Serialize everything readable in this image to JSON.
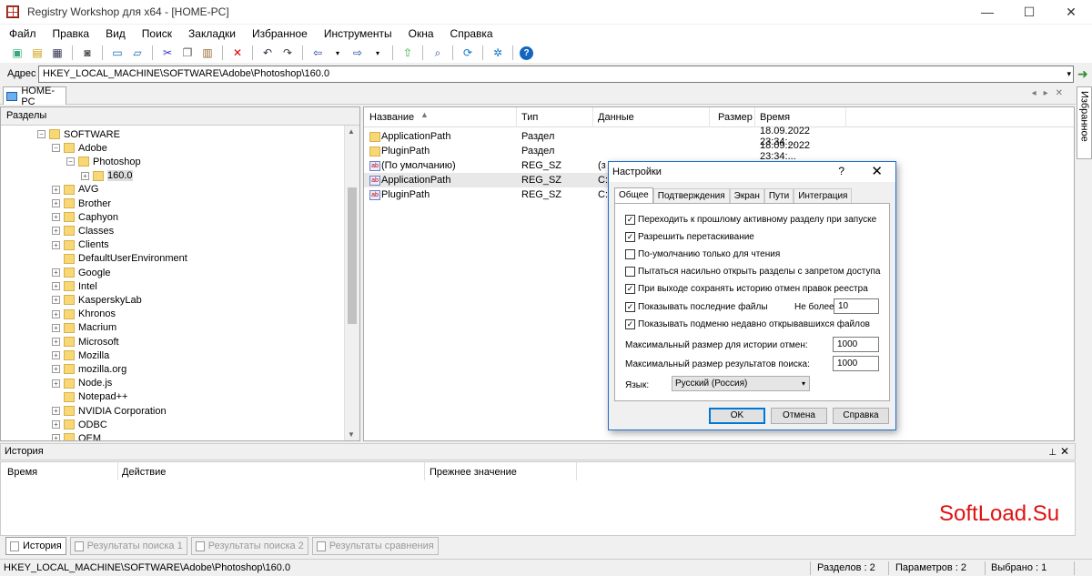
{
  "window": {
    "title": "Registry Workshop для x64 - [HOME-PC]",
    "minimize": "—",
    "maximize": "☐",
    "close": "✕"
  },
  "menu": [
    "Файл",
    "Правка",
    "Вид",
    "Поиск",
    "Закладки",
    "Избранное",
    "Инструменты",
    "Окна",
    "Справка"
  ],
  "address": {
    "label": "Адрес",
    "value": "HKEY_LOCAL_MACHINE\\SOFTWARE\\Adobe\\Photoshop\\160.0"
  },
  "tab": {
    "computer": "HOME-PC",
    "favorites_side": "Избранное"
  },
  "tree": {
    "header": "Разделы",
    "nodes": [
      {
        "label": "SOFTWARE",
        "exp": "−"
      },
      {
        "label": "Adobe",
        "exp": "−"
      },
      {
        "label": "Photoshop",
        "exp": "−"
      },
      {
        "label": "160.0",
        "exp": "+"
      },
      {
        "label": "AVG",
        "exp": "+"
      },
      {
        "label": "Brother",
        "exp": "+"
      },
      {
        "label": "Caphyon",
        "exp": "+"
      },
      {
        "label": "Classes",
        "exp": "+"
      },
      {
        "label": "Clients",
        "exp": "+"
      },
      {
        "label": "DefaultUserEnvironment",
        "exp": ""
      },
      {
        "label": "Google",
        "exp": "+"
      },
      {
        "label": "Intel",
        "exp": "+"
      },
      {
        "label": "KasperskyLab",
        "exp": "+"
      },
      {
        "label": "Khronos",
        "exp": "+"
      },
      {
        "label": "Macrium",
        "exp": "+"
      },
      {
        "label": "Microsoft",
        "exp": "+"
      },
      {
        "label": "Mozilla",
        "exp": "+"
      },
      {
        "label": "mozilla.org",
        "exp": "+"
      },
      {
        "label": "Node.js",
        "exp": "+"
      },
      {
        "label": "Notepad++",
        "exp": ""
      },
      {
        "label": "NVIDIA Corporation",
        "exp": "+"
      },
      {
        "label": "ODBC",
        "exp": "+"
      },
      {
        "label": "OEM",
        "exp": "+"
      }
    ]
  },
  "list": {
    "columns": [
      "Название",
      "Тип",
      "Данные",
      "Размер",
      "Время"
    ],
    "rows": [
      {
        "name": "ApplicationPath",
        "type": "Раздел",
        "data": "",
        "size": "",
        "time": "18.09.2022 23:34:..."
      },
      {
        "name": "PluginPath",
        "type": "Раздел",
        "data": "",
        "size": "",
        "time": "18.09.2022 23:34:..."
      },
      {
        "name": "(По умолчанию)",
        "type": "REG_SZ",
        "data": "(з",
        "size": "",
        "time": ""
      },
      {
        "name": "ApplicationPath",
        "type": "REG_SZ",
        "data": "C:\\",
        "size": "",
        "time": ""
      },
      {
        "name": "PluginPath",
        "type": "REG_SZ",
        "data": "C:\\",
        "size": "",
        "time": ""
      }
    ]
  },
  "dialog": {
    "title": "Настройки",
    "help": "?",
    "close": "✕",
    "tabs": [
      "Общее",
      "Подтверждения",
      "Экран",
      "Пути",
      "Интеграция"
    ],
    "options": [
      {
        "label": "Переходить к прошлому активному разделу при запуске",
        "checked": true
      },
      {
        "label": "Разрешить перетаскивание",
        "checked": true
      },
      {
        "label": "По-умолчанию только для чтения",
        "checked": false
      },
      {
        "label": "Пытаться насильно открыть разделы с запретом доступа",
        "checked": false
      },
      {
        "label": "При выходе сохранять историю отмен правок реестра",
        "checked": true
      },
      {
        "label": "Показывать последние файлы",
        "checked": true
      },
      {
        "label": "Показывать подменю недавно открывавшихся файлов",
        "checked": true
      }
    ],
    "max_label": "Не более:",
    "max_value": "10",
    "undo_label": "Максимальный размер для истории отмен:",
    "undo_value": "1000",
    "search_label": "Максимальный размер результатов поиска:",
    "search_value": "1000",
    "lang_label": "Язык:",
    "lang_value": "Русский (Россия)",
    "ok": "OK",
    "cancel": "Отмена",
    "helpbtn": "Справка"
  },
  "history": {
    "title": "История",
    "columns": [
      "Время",
      "Действие",
      "Прежнее значение"
    ]
  },
  "watermark": "SoftLoad.Su",
  "bottom_tabs": [
    "История",
    "Результаты поиска 1",
    "Результаты поиска 2",
    "Результаты сравнения"
  ],
  "status": {
    "path": "HKEY_LOCAL_MACHINE\\SOFTWARE\\Adobe\\Photoshop\\160.0",
    "sections": "Разделов : 2",
    "params": "Параметров : 2",
    "selected": "Выбрано : 1"
  }
}
